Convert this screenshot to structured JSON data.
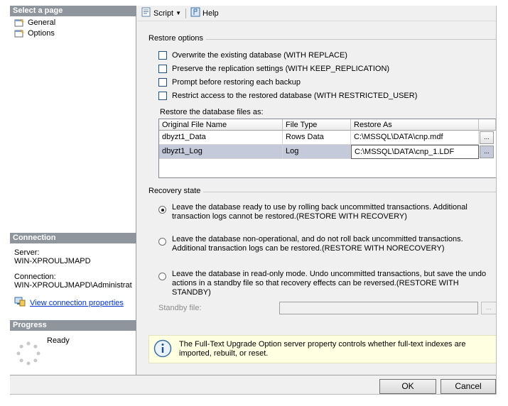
{
  "left": {
    "select_page_header": "Select a page",
    "pages": [
      {
        "label": "General"
      },
      {
        "label": "Options"
      }
    ],
    "connection_header": "Connection",
    "server_label": "Server:",
    "server_value": "WIN-XPROULJMAPD",
    "connection_label": "Connection:",
    "connection_value": "WIN-XPROULJMAPD\\Administrat",
    "view_connection_link": "View connection properties",
    "progress_header": "Progress",
    "progress_status": "Ready"
  },
  "toolbar": {
    "script_label": "Script",
    "help_label": "Help"
  },
  "restore_options": {
    "title": "Restore options",
    "checkboxes": [
      {
        "label": "Overwrite the existing database (WITH REPLACE)",
        "checked": false
      },
      {
        "label": "Preserve the replication settings (WITH KEEP_REPLICATION)",
        "checked": false
      },
      {
        "label": "Prompt before restoring each backup",
        "checked": false
      },
      {
        "label": "Restrict access to the restored database (WITH RESTRICTED_USER)",
        "checked": false
      }
    ]
  },
  "files": {
    "label": "Restore the database files as:",
    "columns": [
      "Original File Name",
      "File Type",
      "Restore As"
    ],
    "rows": [
      {
        "name": "dbyzt1_Data",
        "type": "Rows Data",
        "restore_as": "C:\\MSSQL\\DATA\\cnp.mdf",
        "button": "..."
      },
      {
        "name": "dbyzt1_Log",
        "type": "Log",
        "restore_as": "C:\\MSSQL\\DATA\\cnp_1.LDF",
        "button": "..."
      }
    ]
  },
  "recovery": {
    "title": "Recovery state",
    "options": [
      {
        "text": "Leave the database ready to use by rolling back uncommitted transactions. Additional transaction logs cannot be restored.(RESTORE WITH RECOVERY)",
        "selected": true
      },
      {
        "text": "Leave the database non-operational, and do not roll back uncommitted transactions. Additional transaction logs can be restored.(RESTORE WITH NORECOVERY)",
        "selected": false
      },
      {
        "text": "Leave the database in read-only mode. Undo uncommitted transactions, but save the undo actions in a standby file so that recovery effects can be reversed.(RESTORE WITH STANDBY)",
        "selected": false
      }
    ],
    "standby_label": "Standby file:",
    "standby_value": "",
    "standby_button": "..."
  },
  "info_message": "The Full-Text Upgrade Option server property controls whether full-text indexes are imported, rebuilt, or reset.",
  "buttons": {
    "ok": "OK",
    "cancel": "Cancel"
  },
  "colors": {
    "section_header": "#8e959d",
    "link": "#0033cc",
    "info_background": "#ffffe1",
    "selected_row": "#c4cad9"
  }
}
